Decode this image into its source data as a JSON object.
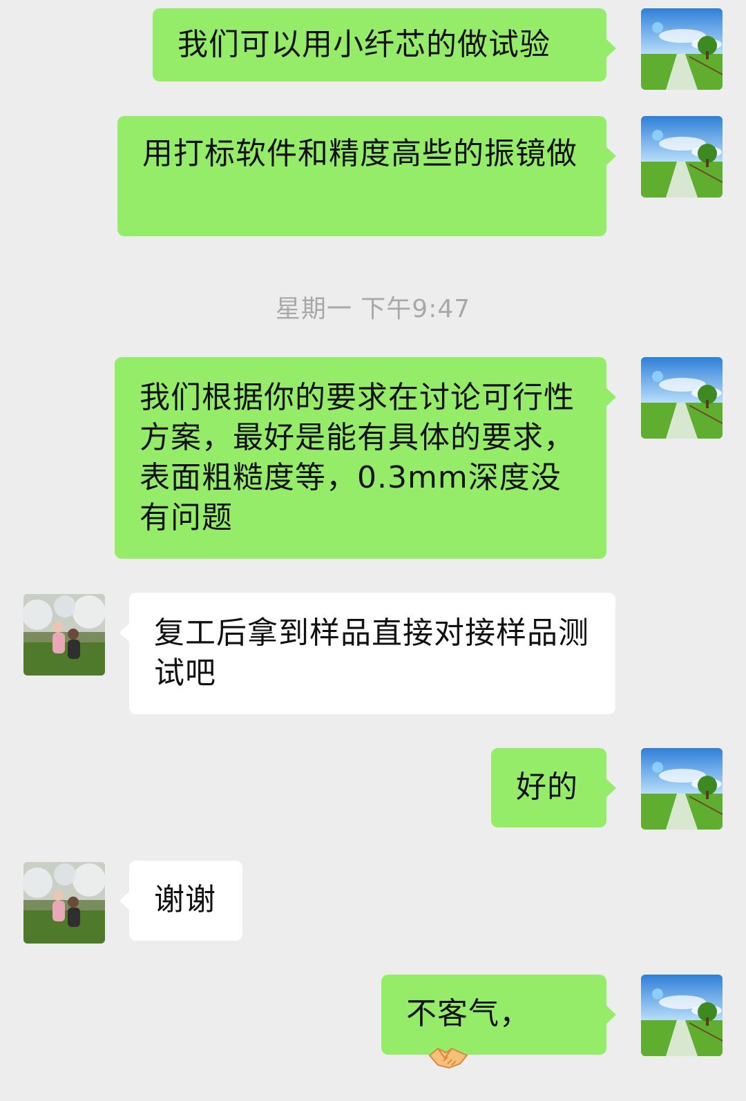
{
  "chat": {
    "timestamp": "星期一 下午9:47",
    "messages": [
      {
        "sender": "self",
        "text": "我们可以用小纤芯的做试验"
      },
      {
        "sender": "self",
        "text": "用打标软件和精度高些的振镜做"
      },
      {
        "sender": "self",
        "text": "我们根据你的要求在讨论可行性方案，最好是能有具体的要求，表面粗糙度等，0.3mm深度没有问题"
      },
      {
        "sender": "other",
        "text": "复工后拿到样品直接对接样品测试吧"
      },
      {
        "sender": "self",
        "text": "好的"
      },
      {
        "sender": "other",
        "text": "谢谢"
      },
      {
        "sender": "self",
        "text": "不客气，",
        "emoji": "handshake-icon"
      }
    ]
  },
  "colors": {
    "background": "#ededed",
    "self_bubble": "#95ec69",
    "other_bubble": "#ffffff",
    "timestamp_text": "#a8a8a8"
  }
}
